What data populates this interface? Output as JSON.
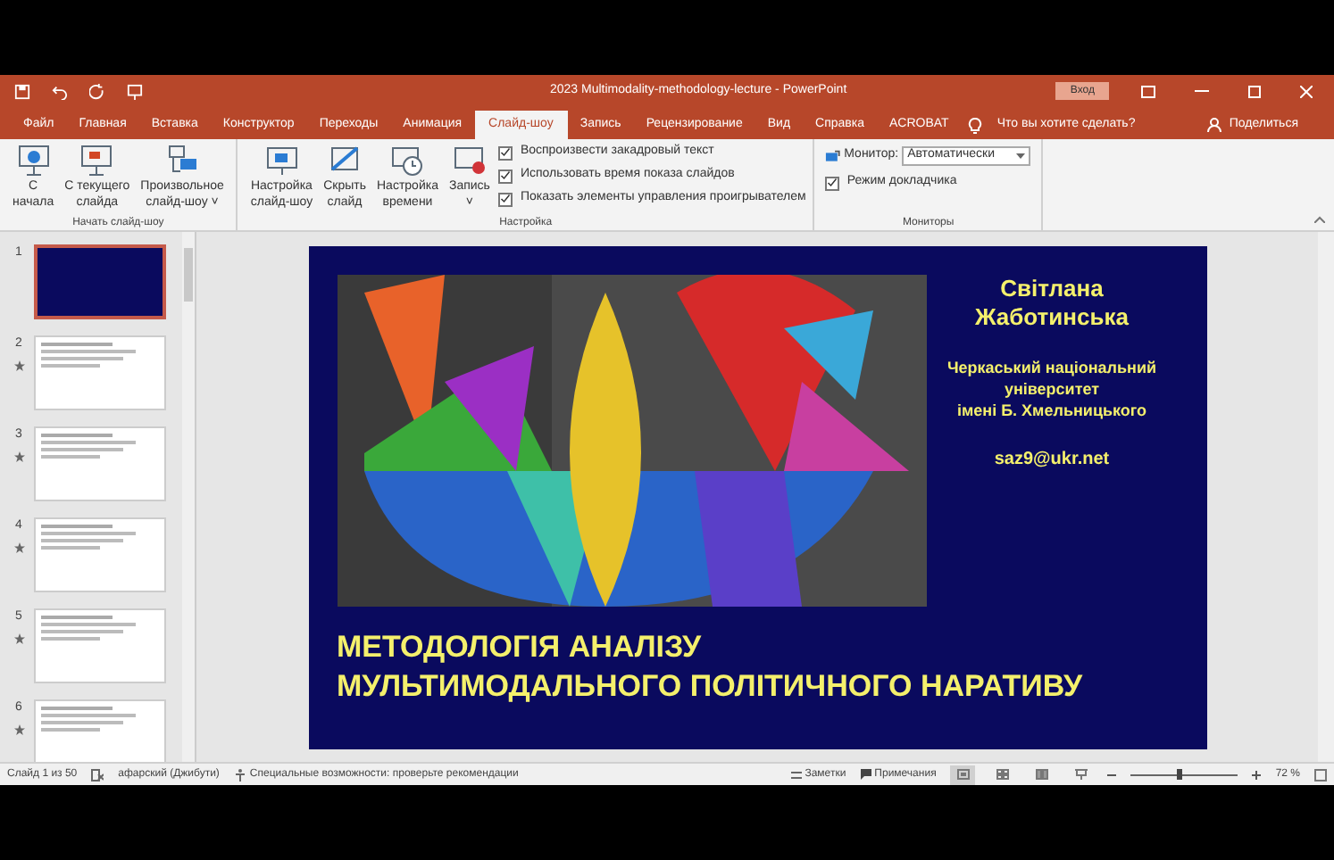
{
  "window": {
    "title": "2023 Multimodality-methodology-lecture  -  PowerPoint",
    "sign_in": "Вход"
  },
  "menu": [
    {
      "label": "Файл",
      "selected": false
    },
    {
      "label": "Главная",
      "selected": false
    },
    {
      "label": "Вставка",
      "selected": false
    },
    {
      "label": "Конструктор",
      "selected": false
    },
    {
      "label": "Переходы",
      "selected": false
    },
    {
      "label": "Анимация",
      "selected": false
    },
    {
      "label": "Слайд-шоу",
      "selected": true
    },
    {
      "label": "Запись",
      "selected": false
    },
    {
      "label": "Рецензирование",
      "selected": false
    },
    {
      "label": "Вид",
      "selected": false
    },
    {
      "label": "Справка",
      "selected": false
    },
    {
      "label": "ACROBAT",
      "selected": false
    }
  ],
  "tell_me": "Что вы хотите сделать?",
  "share": "Поделиться",
  "ribbon": {
    "groups": [
      {
        "label": "Начать слайд-шоу",
        "buttons": [
          {
            "kind": "play",
            "lines": [
              "С",
              "начала"
            ]
          },
          {
            "kind": "current",
            "lines": [
              "С текущего",
              "слайда"
            ]
          },
          {
            "kind": "custom",
            "lines": [
              "Произвольное",
              "слайд-шоу ˅"
            ]
          }
        ]
      },
      {
        "label": "Настройка",
        "buttons": [
          {
            "kind": "setup",
            "lines": [
              "Настройка",
              "слайд-шоу"
            ]
          },
          {
            "kind": "hide",
            "lines": [
              "Скрыть",
              "слайд"
            ]
          },
          {
            "kind": "timing",
            "lines": [
              "Настройка",
              "времени"
            ]
          },
          {
            "kind": "record",
            "lines": [
              "Запись",
              "˅"
            ]
          }
        ],
        "checks": [
          {
            "label": "Воспроизвести закадровый текст",
            "checked": true
          },
          {
            "label": "Использовать время показа слайдов",
            "checked": true
          },
          {
            "label": "Показать элементы управления проигрывателем",
            "checked": true
          }
        ]
      },
      {
        "label": "Мониторы",
        "monitor_label": "Монитор:",
        "monitor_value": "Автоматически",
        "checks": [
          {
            "label": "Режим докладчика",
            "checked": true
          }
        ]
      }
    ]
  },
  "slides": [
    {
      "number": "1",
      "selected": true,
      "transition": false
    },
    {
      "number": "2",
      "selected": false,
      "transition": true
    },
    {
      "number": "3",
      "selected": false,
      "transition": true
    },
    {
      "number": "4",
      "selected": false,
      "transition": true
    },
    {
      "number": "5",
      "selected": false,
      "transition": true
    },
    {
      "number": "6",
      "selected": false,
      "transition": true
    }
  ],
  "slide": {
    "name": [
      "Світлана",
      "Жаботинська"
    ],
    "affiliation": [
      "Черкаський національний",
      "університет",
      "імені Б. Хмельницького"
    ],
    "email": "saz9@ukr.net",
    "title": [
      "МЕТОДОЛОГІЯ АНАЛІЗУ",
      "МУЛЬТИМОДАЛЬНОГО ПОЛІТИЧНОГО НАРАТИВУ"
    ]
  },
  "status_bar": {
    "slide_count": "Слайд 1 из 50",
    "language": "афарский (Джибути)",
    "accessibility": "Специальные возможности: проверьте рекомендации",
    "notes": "Заметки",
    "comments": "Примечания",
    "views": [
      {
        "kind": "normal",
        "selected": true
      },
      {
        "kind": "sorter",
        "selected": false
      },
      {
        "kind": "reading",
        "selected": false
      },
      {
        "kind": "show",
        "selected": false
      }
    ],
    "zoom": {
      "level": 0.45
    },
    "zoom_text": "72 %"
  }
}
